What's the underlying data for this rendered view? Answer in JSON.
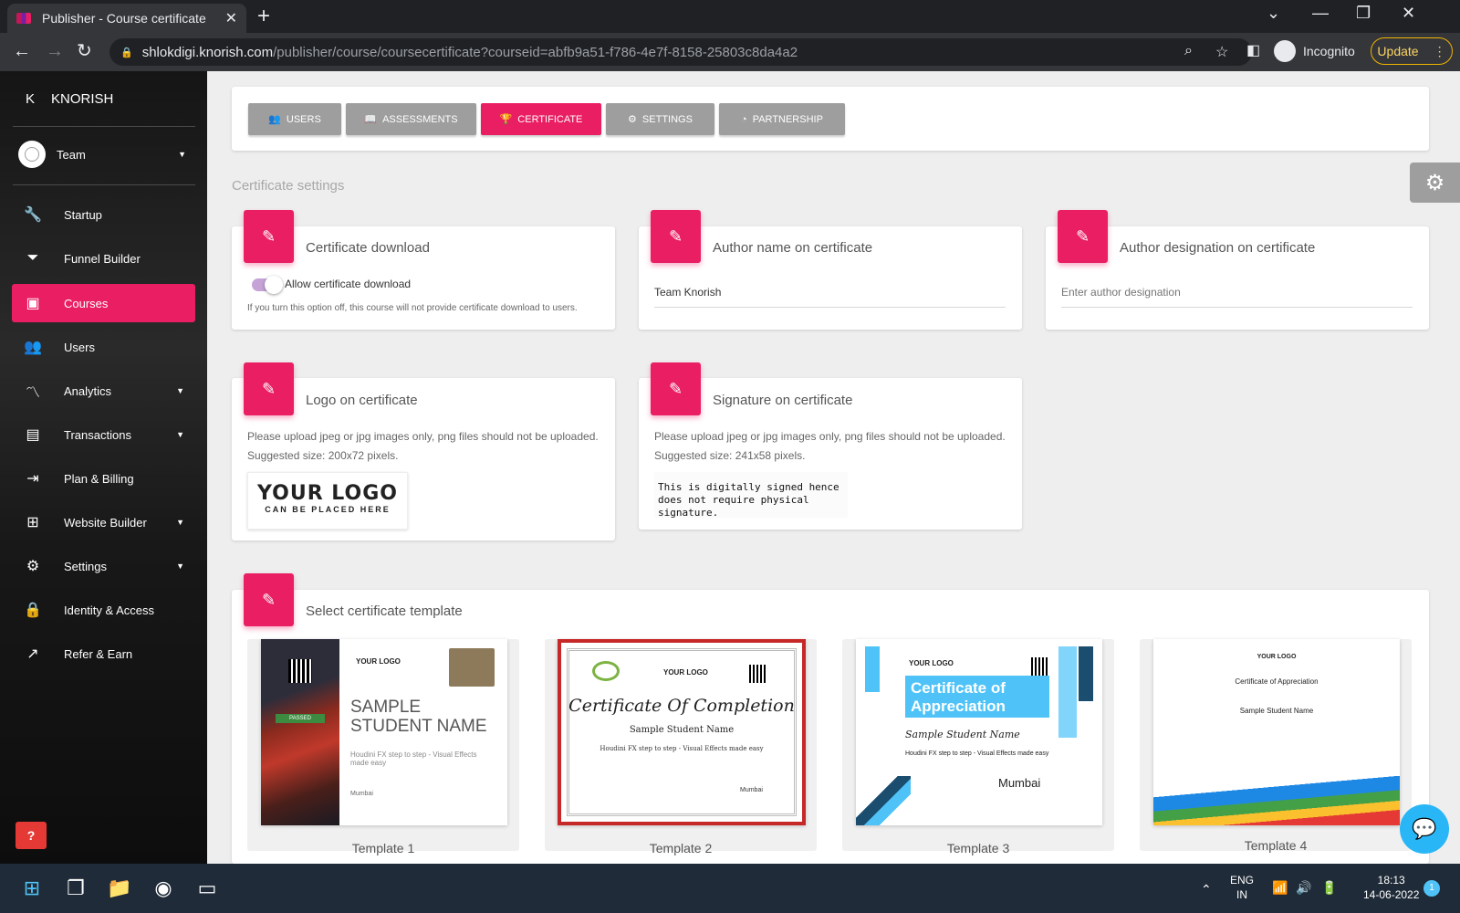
{
  "browser": {
    "tab_title": "Publisher - Course certificate",
    "url_host": "shlokdigi.knorish.com",
    "url_path": "/publisher/course/coursecertificate?courseid=abfb9a51-f786-4e7f-8158-25803c8da4a2",
    "profile_label": "Incognito",
    "update_label": "Update"
  },
  "sidebar": {
    "brand_letter": "K",
    "brand_name": "KNORISH",
    "user_name": "Team",
    "items": [
      {
        "label": "Startup",
        "icon": "wrench-icon"
      },
      {
        "label": "Funnel Builder",
        "icon": "funnel-icon"
      },
      {
        "label": "Courses",
        "icon": "courses-icon",
        "active": true
      },
      {
        "label": "Users",
        "icon": "users-icon"
      },
      {
        "label": "Analytics",
        "icon": "analytics-icon"
      },
      {
        "label": "Transactions",
        "icon": "wallet-icon"
      },
      {
        "label": "Plan & Billing",
        "icon": "billing-icon"
      },
      {
        "label": "Website Builder",
        "icon": "puzzle-icon"
      },
      {
        "label": "Settings",
        "icon": "gear-icon"
      },
      {
        "label": "Identity & Access",
        "icon": "lock-icon"
      },
      {
        "label": "Refer & Earn",
        "icon": "trend-icon"
      }
    ],
    "help_label": "?"
  },
  "tabs": [
    {
      "label": "USERS",
      "icon": "users-icon"
    },
    {
      "label": "ASSESSMENTS",
      "icon": "book-icon"
    },
    {
      "label": "CERTIFICATE",
      "icon": "trophy-icon",
      "active": true
    },
    {
      "label": "SETTINGS",
      "icon": "gear-icon"
    },
    {
      "label": "PARTNERSHIP",
      "icon": "partnership-icon"
    }
  ],
  "section_title": "Certificate settings",
  "download": {
    "title": "Certificate download",
    "toggle_label": "Allow certificate download",
    "toggle_on": true,
    "note": "If you turn this option off, this course will not provide certificate download to users."
  },
  "author_name": {
    "title": "Author name on certificate",
    "value": "Team Knorish"
  },
  "author_designation": {
    "title": "Author designation on certificate",
    "placeholder": "Enter author designation"
  },
  "logo": {
    "title": "Logo on certificate",
    "help_line1": "Please upload jpeg or jpg images only, png files should not be uploaded.",
    "help_line2": "Suggested size: 200x72 pixels.",
    "preview_line1": "YOUR LOGO",
    "preview_line2": "CAN BE PLACED HERE"
  },
  "signature": {
    "title": "Signature on certificate",
    "help_line1": "Please upload jpeg or jpg images only, png files should not be uploaded.",
    "help_line2": "Suggested size: 241x58 pixels.",
    "preview_line1": "This is digitally signed hence",
    "preview_line2": "does not require physical signature."
  },
  "templates": {
    "title": "Select certificate template",
    "items": [
      {
        "label": "Template 1",
        "heading": "SAMPLE STUDENT NAME",
        "logo": "YOUR LOGO",
        "badge": "PASSED",
        "course": "Houdini FX step to step - Visual Effects made easy",
        "city": "Mumbai"
      },
      {
        "label": "Template 2",
        "heading": "Certificate Of Completion",
        "logo": "YOUR LOGO",
        "name": "Sample Student Name",
        "course": "Houdini FX step to step - Visual Effects made easy",
        "city": "Mumbai",
        "selected": true
      },
      {
        "label": "Template 3",
        "heading": "Certificate of Appreciation",
        "logo": "YOUR LOGO",
        "name": "Sample Student Name",
        "course": "Houdini FX step to step - Visual Effects made easy",
        "city": "Mumbai"
      },
      {
        "label": "Template 4",
        "heading": "Certificate of Appreciation",
        "logo": "YOUR LOGO",
        "name": "Sample Student Name"
      }
    ]
  },
  "taskbar": {
    "lang_line1": "ENG",
    "lang_line2": "IN",
    "time": "18:13",
    "date": "14-06-2022",
    "notifications": "1"
  },
  "colors": {
    "accent": "#e91e63",
    "tab_inactive": "#9e9e9e",
    "chat_fab": "#29b6f6"
  }
}
